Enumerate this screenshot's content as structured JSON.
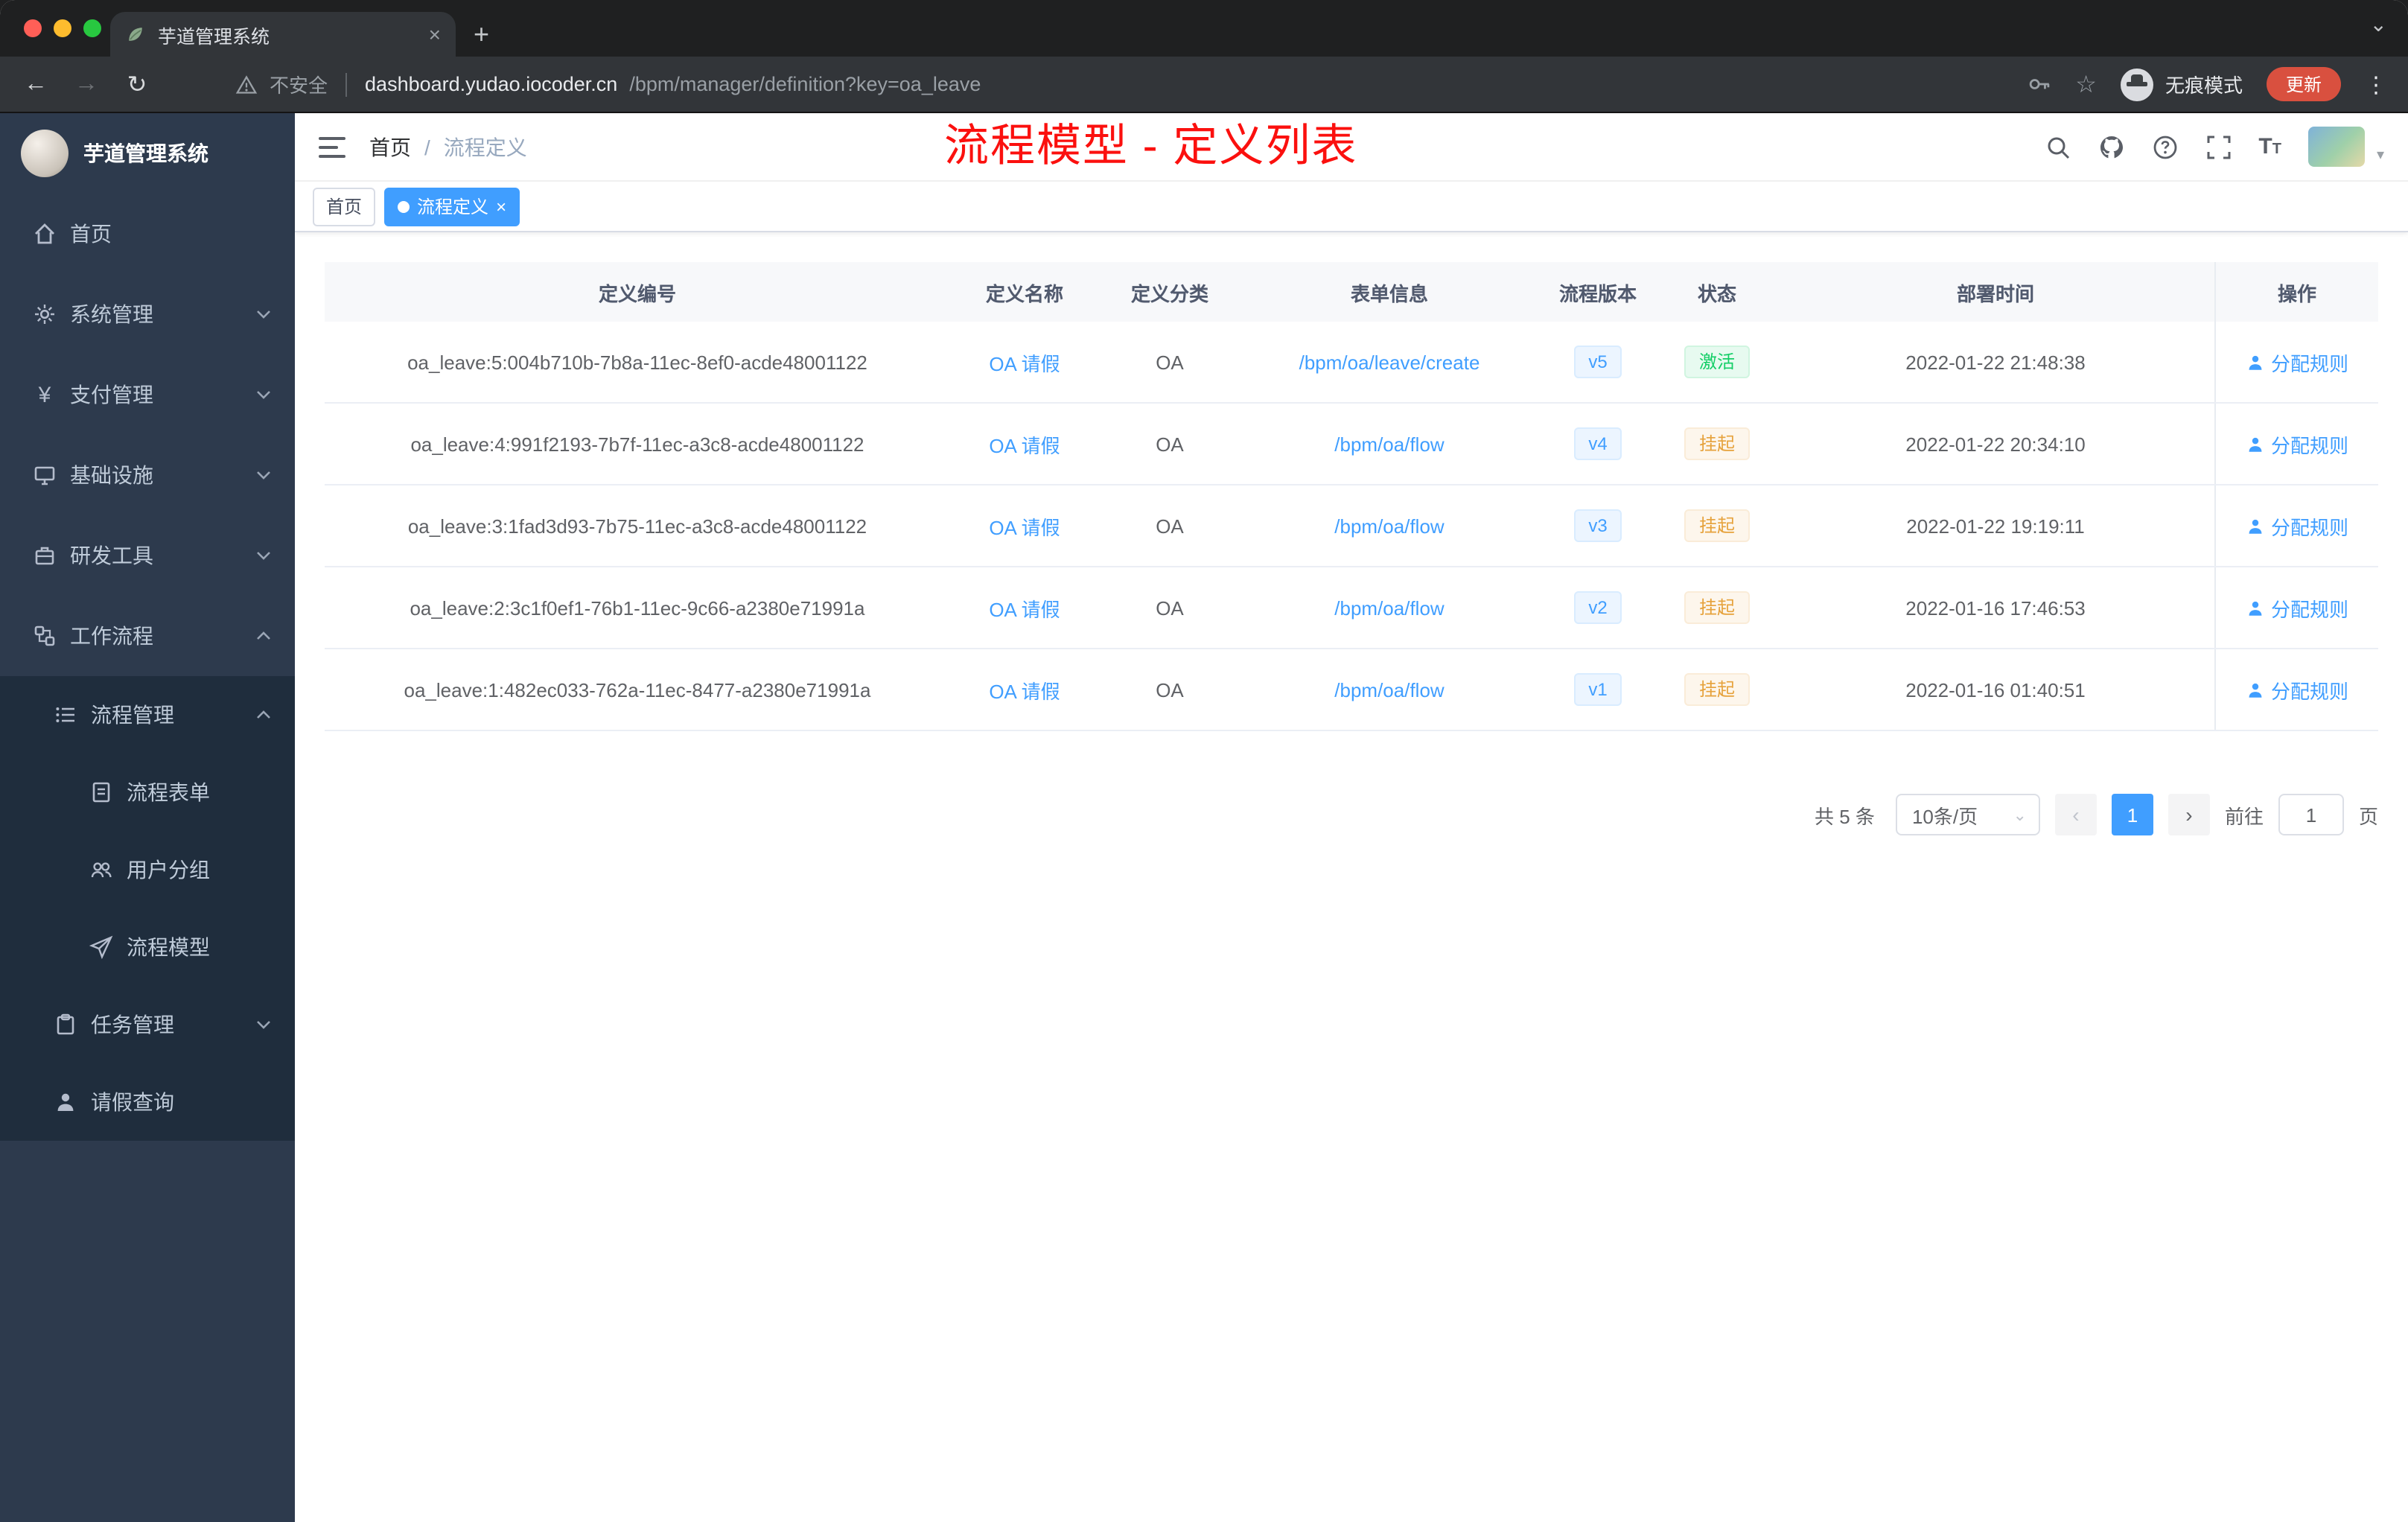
{
  "browser": {
    "tab_title": "芋道管理系统",
    "security_label": "不安全",
    "url_host": "dashboard.yudao.iocoder.cn",
    "url_path": "/bpm/manager/definition?key=oa_leave",
    "incognito_label": "无痕模式",
    "update_label": "更新"
  },
  "glyphs": {
    "close": "×",
    "plus": "+",
    "dots": "⋮",
    "caret_down": "⌄",
    "caret_small": "▾",
    "star": "☆",
    "back": "←",
    "forward": "→",
    "reload": "↻",
    "prev": "‹",
    "next": "›",
    "yen": "¥"
  },
  "sidebar": {
    "title": "芋道管理系统",
    "items": [
      {
        "label": "首页"
      },
      {
        "label": "系统管理"
      },
      {
        "label": "支付管理"
      },
      {
        "label": "基础设施"
      },
      {
        "label": "研发工具"
      },
      {
        "label": "工作流程"
      },
      {
        "label": "流程管理"
      },
      {
        "label": "流程表单"
      },
      {
        "label": "用户分组"
      },
      {
        "label": "流程模型"
      },
      {
        "label": "任务管理"
      },
      {
        "label": "请假查询"
      }
    ]
  },
  "header": {
    "breadcrumb_home": "首页",
    "breadcrumb_sep": "/",
    "breadcrumb_current": "流程定义",
    "annotation": "流程模型 - 定义列表"
  },
  "tags": {
    "home": "首页",
    "active": "流程定义"
  },
  "table": {
    "columns": [
      "定义编号",
      "定义名称",
      "定义分类",
      "表单信息",
      "流程版本",
      "状态",
      "部署时间",
      "操作"
    ],
    "action_label": "分配规则",
    "rows": [
      {
        "id": "oa_leave:5:004b710b-7b8a-11ec-8ef0-acde48001122",
        "name": "OA 请假",
        "category": "OA",
        "form": "/bpm/oa/leave/create",
        "version": "v5",
        "status": "激活",
        "status_type": "success",
        "time": "2022-01-22 21:48:38"
      },
      {
        "id": "oa_leave:4:991f2193-7b7f-11ec-a3c8-acde48001122",
        "name": "OA 请假",
        "category": "OA",
        "form": "/bpm/oa/flow",
        "version": "v4",
        "status": "挂起",
        "status_type": "warning",
        "time": "2022-01-22 20:34:10"
      },
      {
        "id": "oa_leave:3:1fad3d93-7b75-11ec-a3c8-acde48001122",
        "name": "OA 请假",
        "category": "OA",
        "form": "/bpm/oa/flow",
        "version": "v3",
        "status": "挂起",
        "status_type": "warning",
        "time": "2022-01-22 19:19:11"
      },
      {
        "id": "oa_leave:2:3c1f0ef1-76b1-11ec-9c66-a2380e71991a",
        "name": "OA 请假",
        "category": "OA",
        "form": "/bpm/oa/flow",
        "version": "v2",
        "status": "挂起",
        "status_type": "warning",
        "time": "2022-01-16 17:46:53"
      },
      {
        "id": "oa_leave:1:482ec033-762a-11ec-8477-a2380e71991a",
        "name": "OA 请假",
        "category": "OA",
        "form": "/bpm/oa/flow",
        "version": "v1",
        "status": "挂起",
        "status_type": "warning",
        "time": "2022-01-16 01:40:51"
      }
    ]
  },
  "pagination": {
    "total": "共 5 条",
    "page_size": "10条/页",
    "current": "1",
    "goto_prefix": "前往",
    "goto_value": "1",
    "goto_suffix": "页"
  },
  "colors": {
    "accent": "#409eff",
    "success": "#13ce66",
    "warning": "#e6a23c",
    "annotation": "#fb100e",
    "sidebar_bg": "#2d3a4d",
    "sidebar_sub_bg": "#1f2d3d"
  }
}
